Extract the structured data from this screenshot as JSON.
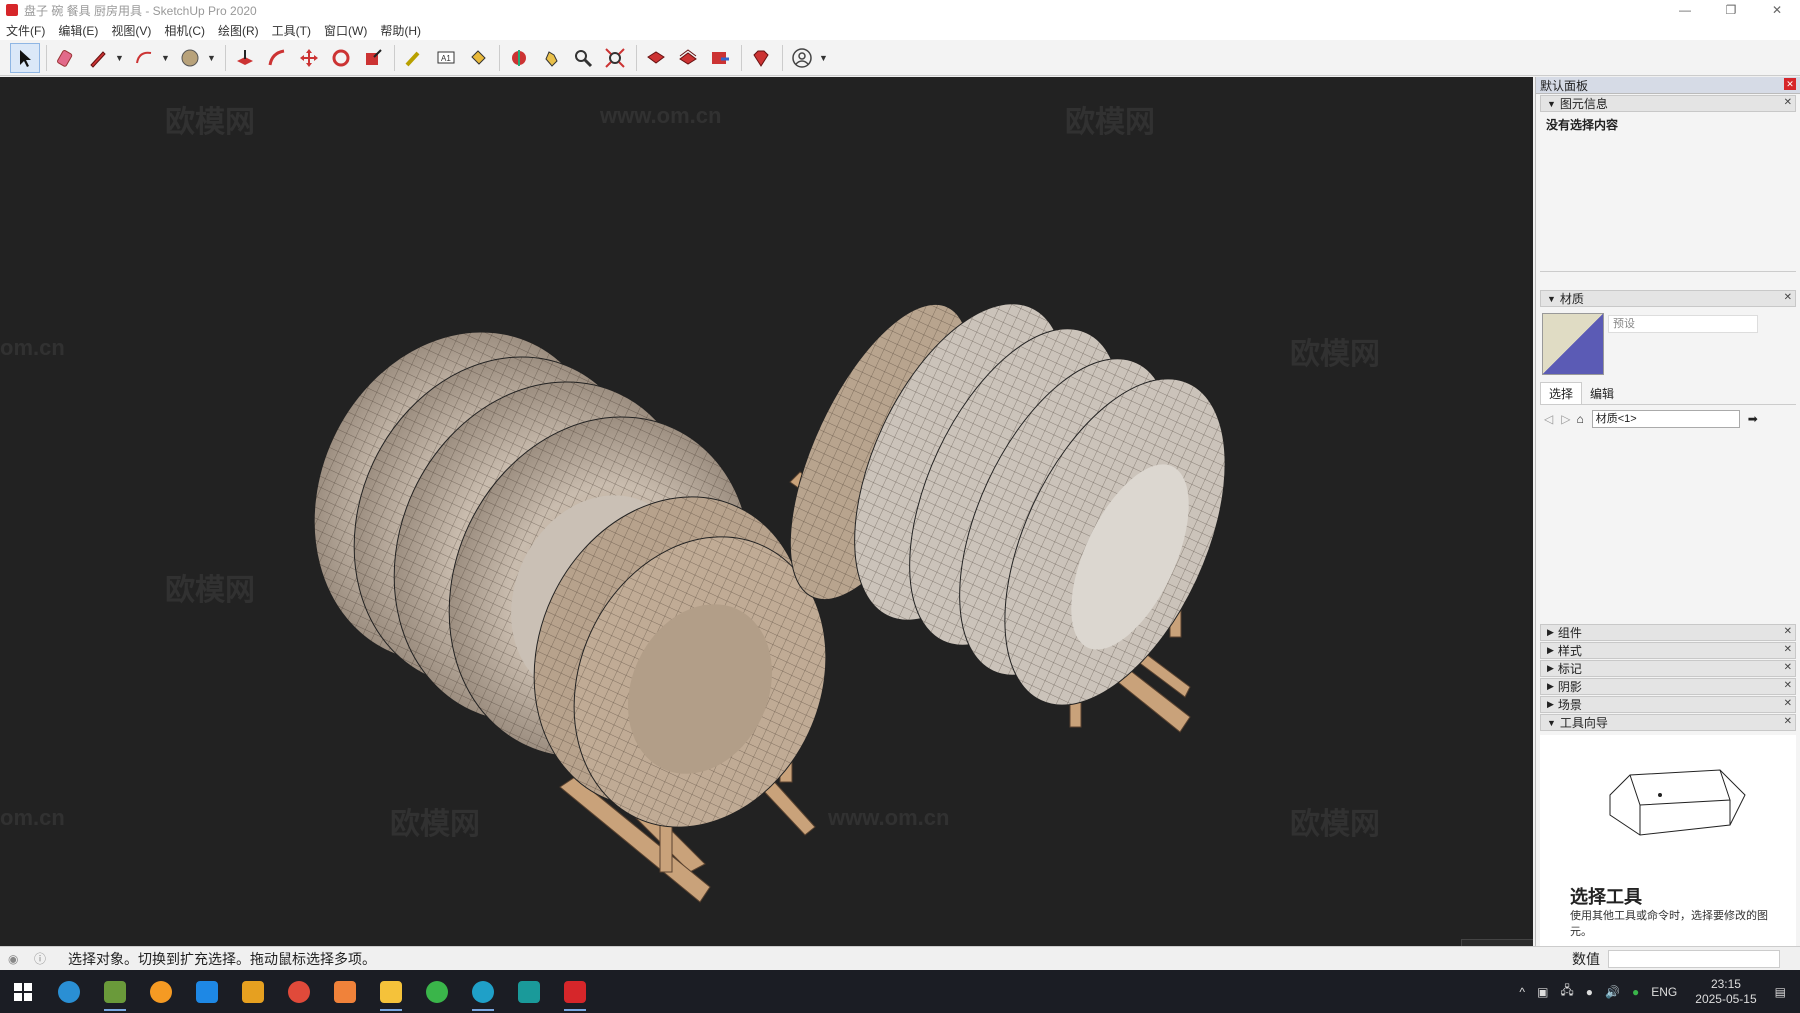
{
  "window": {
    "title": "盘子 碗 餐具 厨房用具 - SketchUp Pro 2020",
    "min": "—",
    "restore": "❐",
    "close": "✕"
  },
  "menu": [
    "文件(F)",
    "编辑(E)",
    "视图(V)",
    "相机(C)",
    "绘图(R)",
    "工具(T)",
    "窗口(W)",
    "帮助(H)"
  ],
  "toolbar": {
    "tools": [
      "select-tool",
      "eraser-tool",
      "line-tool",
      "arc-tool",
      "shape-tool",
      "push-pull-tool",
      "offset-tool",
      "move-tool",
      "rotate-tool",
      "scale-tool",
      "tape-measure-tool",
      "text-tool",
      "paint-bucket-tool",
      "orbit-tool",
      "pan-tool",
      "zoom-tool",
      "zoom-extents-tool",
      "warehouse-tool",
      "extension-warehouse-tool",
      "layout-tool",
      "ruby-tool",
      "account-tool"
    ]
  },
  "watermarks": [
    "欧模网",
    "www.om.cn",
    "om.cn"
  ],
  "panel": {
    "title": "默认面板",
    "entity_info": {
      "header": "图元信息",
      "content": "没有选择内容"
    },
    "materials": {
      "header": "材质",
      "name_placeholder": "预设",
      "tab_select": "选择",
      "tab_edit": "编辑",
      "dropdown": "材质<1>"
    },
    "collapsed": [
      "组件",
      "样式",
      "标记",
      "阴影",
      "场景"
    ],
    "instructor": {
      "header": "工具向导",
      "title": "选择工具",
      "desc": "使用其他工具或命令时，选择要修改的图元。"
    }
  },
  "status": {
    "message": "选择对象。切换到扩充选择。拖动鼠标选择多项。",
    "measure_label": "数值"
  },
  "taskbar": {
    "lang": "ENG",
    "time": "23:15",
    "date": "2025-05-15"
  },
  "colors": {
    "viewport": "#222222",
    "plate": "#c9bcae",
    "rack": "#c9a27a"
  }
}
